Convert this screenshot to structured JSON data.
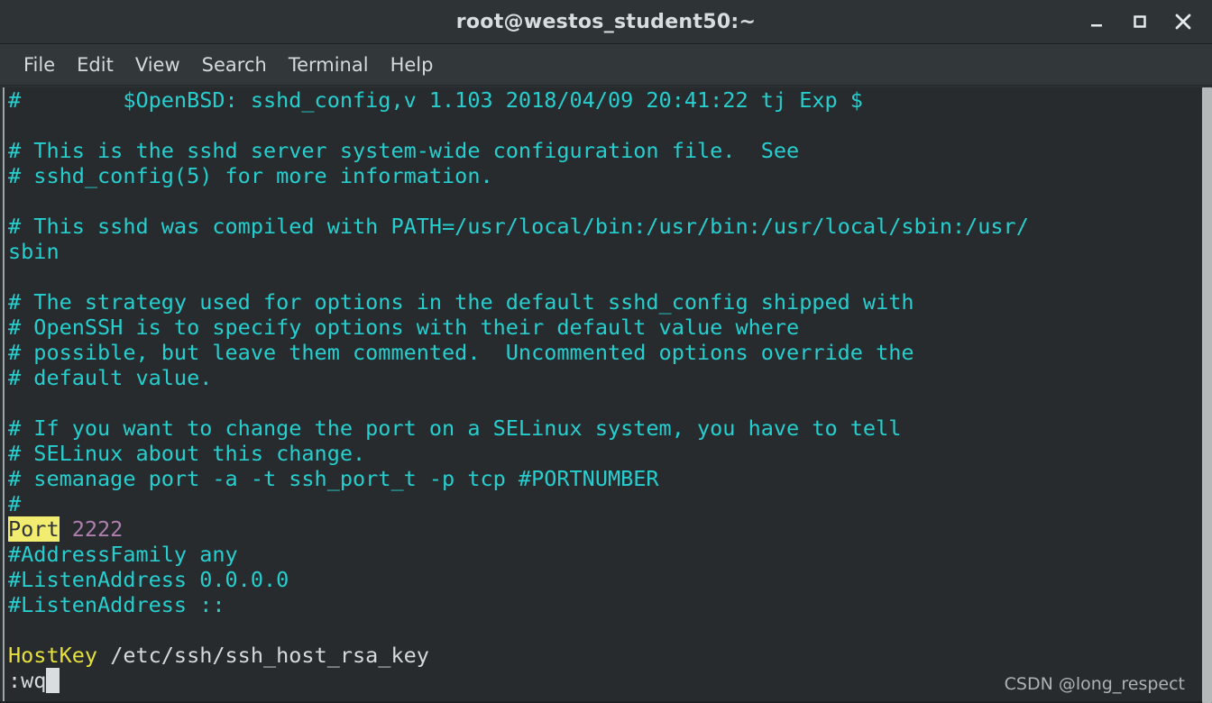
{
  "window": {
    "title": "root@westos_student50:~",
    "controls": [
      {
        "name": "minimize-button",
        "icon": "minimize-icon"
      },
      {
        "name": "maximize-button",
        "icon": "maximize-icon"
      },
      {
        "name": "close-button",
        "icon": "close-icon"
      }
    ]
  },
  "menubar": {
    "items": [
      "File",
      "Edit",
      "View",
      "Search",
      "Terminal",
      "Help"
    ]
  },
  "terminal": {
    "colors": {
      "background": "#272b2e",
      "comment": "#26cfcf",
      "foreground": "#d6dadd",
      "keyword_yellow": "#e8e03a",
      "value_purple": "#b07fb0",
      "search_highlight_bg": "#f2ec70",
      "search_highlight_fg": "#30343a",
      "cursor": "#d9dddd"
    },
    "lines": [
      {
        "id": "l01",
        "segments": [
          {
            "text": "#        $OpenBSD: sshd_config,v 1.103 2018/04/09 20:41:22 tj Exp $",
            "style": "comment"
          }
        ]
      },
      {
        "id": "l02",
        "segments": [
          {
            "text": "",
            "style": "comment"
          }
        ]
      },
      {
        "id": "l03",
        "segments": [
          {
            "text": "# This is the sshd server system-wide configuration file.  See",
            "style": "comment"
          }
        ]
      },
      {
        "id": "l04",
        "segments": [
          {
            "text": "# sshd_config(5) for more information.",
            "style": "comment"
          }
        ]
      },
      {
        "id": "l05",
        "segments": [
          {
            "text": "",
            "style": "comment"
          }
        ]
      },
      {
        "id": "l06",
        "segments": [
          {
            "text": "# This sshd was compiled with PATH=/usr/local/bin:/usr/bin:/usr/local/sbin:/usr/",
            "style": "comment"
          }
        ]
      },
      {
        "id": "l07",
        "segments": [
          {
            "text": "sbin",
            "style": "comment"
          }
        ]
      },
      {
        "id": "l08",
        "segments": [
          {
            "text": "",
            "style": "comment"
          }
        ]
      },
      {
        "id": "l09",
        "segments": [
          {
            "text": "# The strategy used for options in the default sshd_config shipped with",
            "style": "comment"
          }
        ]
      },
      {
        "id": "l10",
        "segments": [
          {
            "text": "# OpenSSH is to specify options with their default value where",
            "style": "comment"
          }
        ]
      },
      {
        "id": "l11",
        "segments": [
          {
            "text": "# possible, but leave them commented.  Uncommented options override the",
            "style": "comment"
          }
        ]
      },
      {
        "id": "l12",
        "segments": [
          {
            "text": "# default value.",
            "style": "comment"
          }
        ]
      },
      {
        "id": "l13",
        "segments": [
          {
            "text": "",
            "style": "comment"
          }
        ]
      },
      {
        "id": "l14",
        "segments": [
          {
            "text": "# If you want to change the port on a SELinux system, you have to tell",
            "style": "comment"
          }
        ]
      },
      {
        "id": "l15",
        "segments": [
          {
            "text": "# SELinux about this change.",
            "style": "comment"
          }
        ]
      },
      {
        "id": "l16",
        "segments": [
          {
            "text": "# semanage port -a -t ssh_port_t -p tcp #PORTNUMBER",
            "style": "comment"
          }
        ]
      },
      {
        "id": "l17",
        "segments": [
          {
            "text": "#",
            "style": "comment"
          }
        ]
      },
      {
        "id": "l18",
        "segments": [
          {
            "text": "Port",
            "style": "search-highlight"
          },
          {
            "text": " 2222",
            "style": "purple"
          }
        ]
      },
      {
        "id": "l19",
        "segments": [
          {
            "text": "#AddressFamily any",
            "style": "comment"
          }
        ]
      },
      {
        "id": "l20",
        "segments": [
          {
            "text": "#ListenAddress 0.0.0.0",
            "style": "comment"
          }
        ]
      },
      {
        "id": "l21",
        "segments": [
          {
            "text": "#ListenAddress ::",
            "style": "comment"
          }
        ]
      },
      {
        "id": "l22",
        "segments": [
          {
            "text": "",
            "style": "comment"
          }
        ]
      },
      {
        "id": "l23",
        "segments": [
          {
            "text": "HostKey",
            "style": "yellow"
          },
          {
            "text": " /etc/ssh/ssh_host_rsa_key",
            "style": "white"
          }
        ]
      },
      {
        "id": "l24",
        "segments": [
          {
            "text": ":wq",
            "style": "white"
          },
          {
            "text": " ",
            "style": "cursor"
          }
        ]
      }
    ]
  },
  "watermark": "CSDN @long_respect"
}
